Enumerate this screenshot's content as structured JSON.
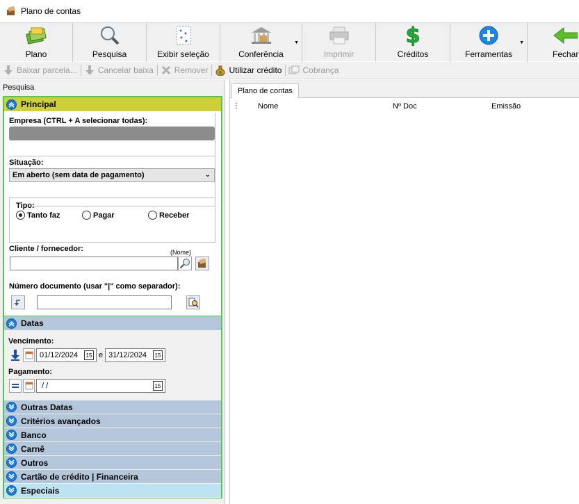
{
  "window": {
    "title": "Plano de contas"
  },
  "toolbar": {
    "items": [
      {
        "label": "Plano",
        "icon": "money-stack-icon"
      },
      {
        "label": "Pesquisa",
        "icon": "magnifier-icon"
      },
      {
        "label": "Exibir seleção",
        "icon": "selection-grid-icon"
      },
      {
        "label": "Conferência",
        "icon": "bank-building-icon"
      },
      {
        "label": "Imprimir",
        "icon": "printer-icon"
      },
      {
        "label": "Créditos",
        "icon": "dollar-icon"
      },
      {
        "label": "Ferramentas",
        "icon": "plus-circle-icon"
      },
      {
        "label": "Fechar",
        "icon": "arrow-left-icon"
      }
    ]
  },
  "toolbar2": {
    "items": [
      {
        "label": "Baixar parcela...",
        "icon": "arrow-down-icon"
      },
      {
        "label": "Cancelar baixa",
        "icon": "arrow-down-icon"
      },
      {
        "label": "Remover",
        "icon": "remove-icon"
      },
      {
        "label": "Utilizar crédito",
        "icon": "money-bag-icon"
      },
      {
        "label": "Cobrança",
        "icon": "documents-icon"
      }
    ]
  },
  "left": {
    "header": "Pesquisa",
    "principal": {
      "title": "Principal",
      "empresa_label": "Empresa (CTRL + A selecionar todas):",
      "situacao_label": "Situação:",
      "situacao_value": "Em aberto (sem data de pagamento)",
      "tipo_label": "Tipo:",
      "tipo_options": [
        "Tanto faz",
        "Pagar",
        "Receber"
      ],
      "tipo_selected": "Tanto faz",
      "cliente_label": "Cliente / fornecedor:",
      "cliente_hint": "(Nome)",
      "cliente_value": "",
      "numero_label": "Número documento (usar \"|\" como separador):",
      "numero_value": ""
    },
    "datas": {
      "title": "Datas",
      "vencimento_label": "Vencimento:",
      "venc_from": "01/12/2024",
      "venc_sep": "e",
      "venc_to": "31/12/2024",
      "pagamento_label": "Pagamento:",
      "pag_value": " / /"
    },
    "collapsed_sections": [
      "Outras Datas",
      "Critérios avançados",
      "Banco",
      "Carnê",
      "Outros",
      "Cartão de crédito | Financeira",
      "Especiais"
    ]
  },
  "right": {
    "tab": "Plano de contas",
    "columns": [
      "Nome",
      "Nº Doc",
      "Emissão"
    ]
  }
}
